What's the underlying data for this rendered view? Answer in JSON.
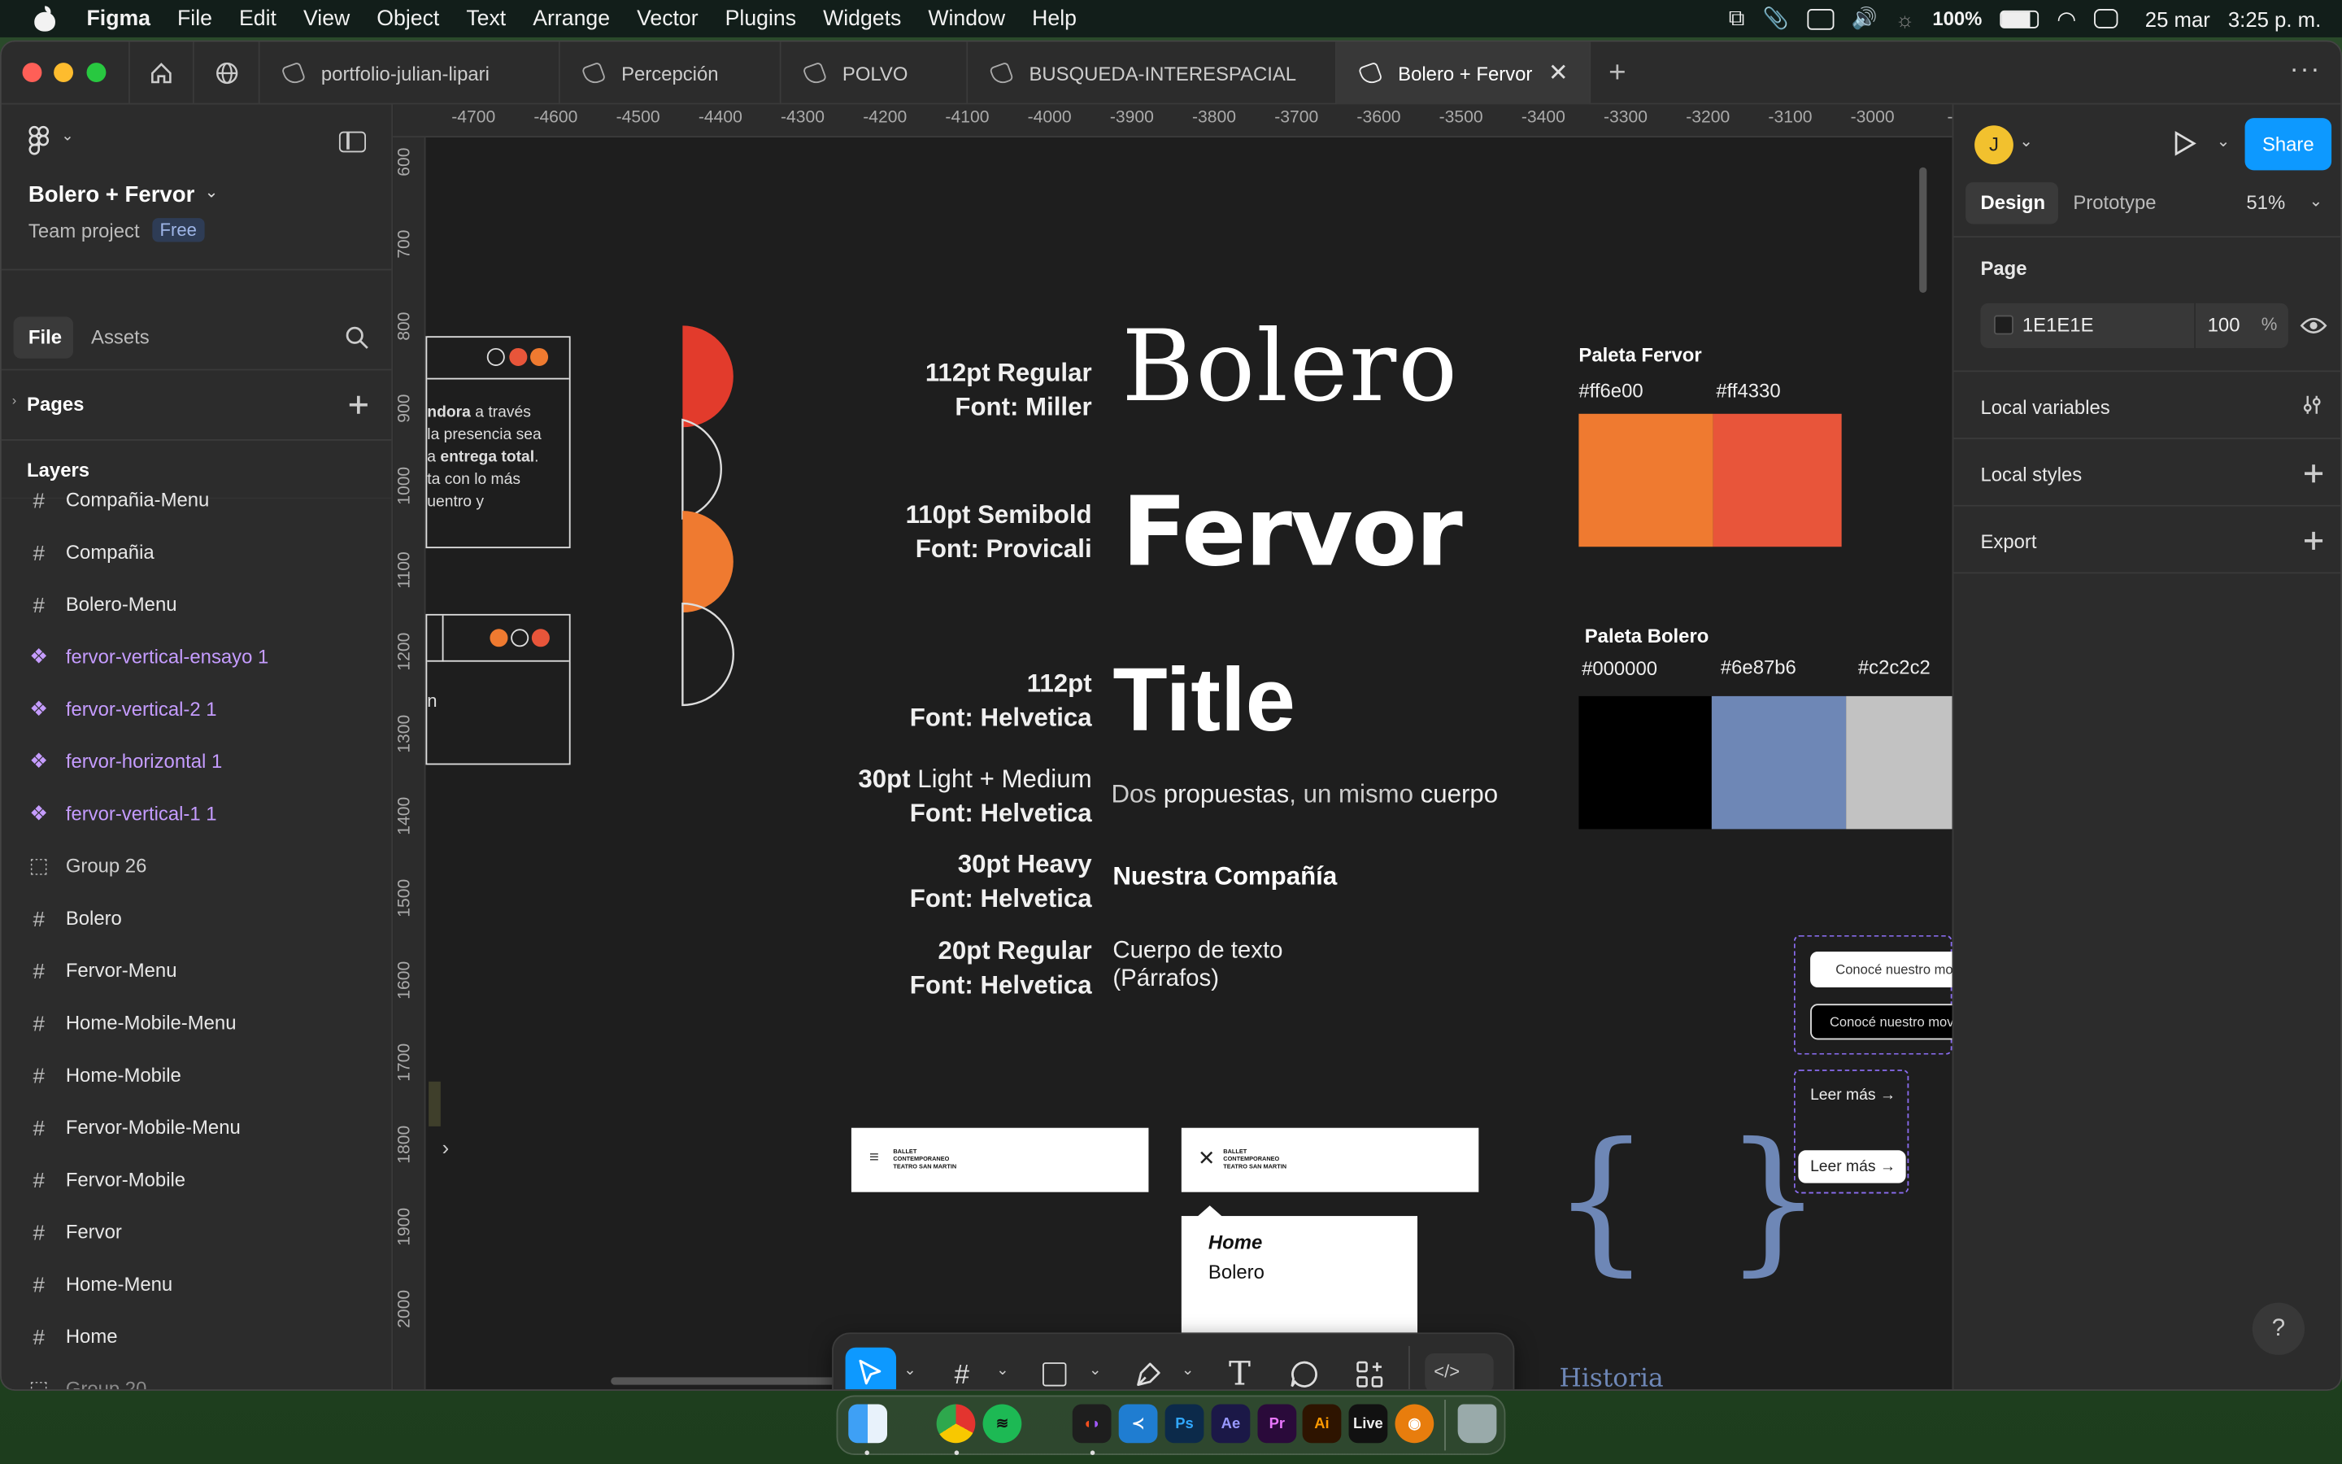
{
  "menubar": {
    "app": "Figma",
    "items": [
      "File",
      "Edit",
      "View",
      "Object",
      "Text",
      "Arrange",
      "Vector",
      "Plugins",
      "Widgets",
      "Window",
      "Help"
    ],
    "battery": "100%",
    "date": "25 mar",
    "time": "3:25 p. m."
  },
  "tabs": [
    "portfolio-julian-lipari",
    "Percepción",
    "POLVO",
    "BUSQUEDA-INTERESPACIAL",
    "Bolero + Fervor"
  ],
  "file": {
    "name": "Bolero + Fervor",
    "team": "Team project",
    "plan": "Free"
  },
  "left_tabs": {
    "file": "File",
    "assets": "Assets"
  },
  "pages_label": "Pages",
  "layers_label": "Layers",
  "layers": [
    {
      "type": "frame",
      "name": "Compañia-Menu"
    },
    {
      "type": "frame",
      "name": "Compañia"
    },
    {
      "type": "frame",
      "name": "Bolero-Menu"
    },
    {
      "type": "component",
      "name": "fervor-vertical-ensayo 1"
    },
    {
      "type": "component",
      "name": "fervor-vertical-2 1"
    },
    {
      "type": "component",
      "name": "fervor-horizontal 1"
    },
    {
      "type": "component",
      "name": "fervor-vertical-1 1"
    },
    {
      "type": "group",
      "name": "Group 26"
    },
    {
      "type": "frame",
      "name": "Bolero"
    },
    {
      "type": "frame",
      "name": "Fervor-Menu"
    },
    {
      "type": "frame",
      "name": "Home-Mobile-Menu"
    },
    {
      "type": "frame",
      "name": "Home-Mobile"
    },
    {
      "type": "frame",
      "name": "Fervor-Mobile-Menu"
    },
    {
      "type": "frame",
      "name": "Fervor-Mobile"
    },
    {
      "type": "frame",
      "name": "Fervor"
    },
    {
      "type": "frame",
      "name": "Home-Menu"
    },
    {
      "type": "frame",
      "name": "Home"
    },
    {
      "type": "group",
      "name": "Group 20"
    }
  ],
  "ruler_x": [
    "-4700",
    "-4600",
    "-4500",
    "-4400",
    "-4300",
    "-4200",
    "-4100",
    "-4000",
    "-3900",
    "-3800",
    "-3700",
    "-3600",
    "-3500",
    "-3400",
    "-3300",
    "-3200",
    "-3100",
    "-3000",
    "-2"
  ],
  "ruler_y": [
    "600",
    "700",
    "800",
    "900",
    "1000",
    "1100",
    "1200",
    "1300",
    "1400",
    "1500",
    "1600",
    "1700",
    "1800",
    "1900",
    "2000",
    "00"
  ],
  "right": {
    "avatar": "J",
    "share": "Share",
    "tab_design": "Design",
    "tab_prototype": "Prototype",
    "zoom": "51%",
    "page_label": "Page",
    "bg_hex": "1E1E1E",
    "bg_opacity": "100",
    "pct": "%",
    "local_variables": "Local variables",
    "local_styles": "Local styles",
    "export": "Export"
  },
  "canvas": {
    "type_rows": [
      {
        "l1": "112pt Regular",
        "l2": "Font: Miller",
        "sample": "Bolero"
      },
      {
        "l1": "110pt Semibold",
        "l2": "Font: Provicali",
        "sample": "Fervor"
      },
      {
        "l1": "112pt",
        "l2": "Font: Helvetica",
        "sample": "Title"
      },
      {
        "l1a": "30pt",
        "l1b": " Light + Medium",
        "l2": "Font: Helvetica",
        "s_light1": "Dos ",
        "s_med1": "propuestas",
        "s_light2": ", un mismo ",
        "s_med2": "cuerpo"
      },
      {
        "l1": "30pt Heavy",
        "l2": "Font: Helvetica",
        "sample": "Nuestra Compañía"
      },
      {
        "l1": "20pt Regular",
        "l2": "Font: Helvetica",
        "sample1": "Cuerpo de texto",
        "sample2": "(Párrafos)"
      }
    ],
    "fervor_title": "Paleta Fervor",
    "fervor_colors": [
      {
        "hex": "#ff6e00",
        "fill": "#ef7a30"
      },
      {
        "hex": "#ff4330",
        "fill": "#e8553a"
      }
    ],
    "bolero_title": "Paleta Bolero",
    "bolero_colors": [
      {
        "hex": "#000000",
        "fill": "#000000"
      },
      {
        "hex": "#6e87b6",
        "fill": "#6e87b6"
      },
      {
        "hex": "#c2c2c2",
        "fill": "#c2c2c2"
      }
    ],
    "partial_text": {
      "a1": "ndora",
      "a2": " a través",
      "b": "la presencia sea",
      "c1": "a ",
      "c2": "entrega total",
      "c3": ".",
      "d": "ta con lo más",
      "e": "uentro y",
      "f": "n"
    },
    "btn1": "Conocé nuestro mov",
    "btn2": "Conocé nuestro movin",
    "leer1": "Leer más →",
    "leer2": "Leer más →",
    "logo_l1": "BALLET",
    "logo_l2": "CONTEMPORANEO",
    "logo_l3": "TEATRO SAN MARTIN",
    "menu_items": [
      "Home",
      "Bolero"
    ],
    "historia": "Historia",
    "braces": "{ }"
  },
  "dock": [
    "Finder",
    "Chrome",
    "Spotify",
    "Figma",
    "VS Code",
    "Ps",
    "Ae",
    "Pr",
    "Ai",
    "Live",
    "Blender",
    "Trash"
  ]
}
